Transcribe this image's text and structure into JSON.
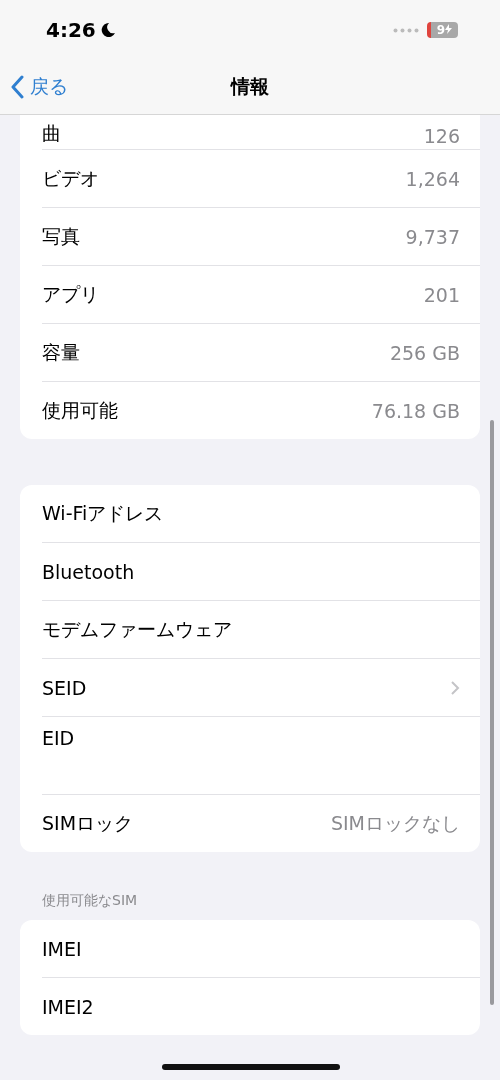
{
  "status_bar": {
    "time": "4:26",
    "battery": "9"
  },
  "nav": {
    "back": "戻る",
    "title": "情報"
  },
  "groups": [
    {
      "rows": [
        {
          "kind": "partial",
          "label": "曲",
          "value": "126"
        },
        {
          "kind": "value",
          "label": "ビデオ",
          "value": "1,264"
        },
        {
          "kind": "value",
          "label": "写真",
          "value": "9,737"
        },
        {
          "kind": "value",
          "label": "アプリ",
          "value": "201"
        },
        {
          "kind": "value",
          "label": "容量",
          "value": "256 GB"
        },
        {
          "kind": "value",
          "label": "使用可能",
          "value": "76.18 GB"
        }
      ]
    },
    {
      "rows": [
        {
          "kind": "plain",
          "label": "Wi-Fiアドレス"
        },
        {
          "kind": "plain",
          "label": "Bluetooth"
        },
        {
          "kind": "plain",
          "label": "モデムファームウェア"
        },
        {
          "kind": "link",
          "label": "SEID"
        },
        {
          "kind": "tall",
          "label": "EID"
        },
        {
          "kind": "value",
          "label": "SIMロック",
          "value": "SIMロックなし"
        }
      ]
    },
    {
      "header": "使用可能なSIM",
      "rows": [
        {
          "kind": "plain",
          "label": "IMEI"
        },
        {
          "kind": "plain",
          "label": "IMEI2"
        }
      ]
    }
  ]
}
